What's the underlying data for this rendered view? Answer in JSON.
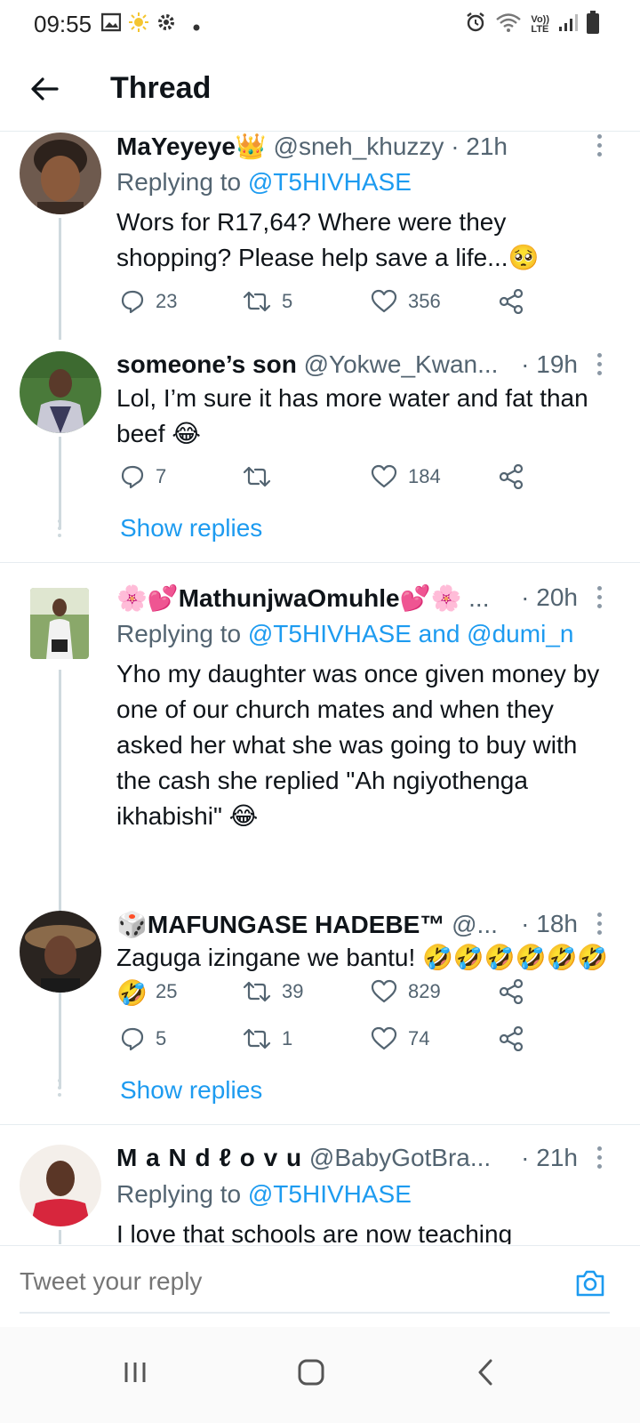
{
  "status_bar": {
    "time": "09:55",
    "left_icons": [
      "gallery-icon",
      "sun-icon",
      "gear-icon",
      "dot-icon"
    ],
    "right_icons": [
      "alarm-icon",
      "wifi-icon",
      "volte-icon",
      "signal-icon",
      "battery-icon"
    ],
    "volte_label_top": "Vo))",
    "volte_label_bottom": "LTE"
  },
  "header": {
    "title": "Thread",
    "back_icon": "back-arrow-icon"
  },
  "tweets": [
    {
      "name": "MaYeyeye👑",
      "handle": "@sneh_khuzzy",
      "time": "· 21h",
      "replying_prefix": "Replying to ",
      "replying_to": "@T5HIVHASE",
      "text": "Wors for R17,64? Where were they shopping? Please help save a life...🥺",
      "replies": "23",
      "retweets": "5",
      "likes": "356"
    },
    {
      "name": "someone’s son",
      "handle": "@Yokwe_Kwan...",
      "time": "· 19h",
      "text": "Lol, I’m sure it has more water and fat than beef 😂",
      "replies": "7",
      "retweets": "",
      "likes": "184",
      "show_replies": "Show replies"
    },
    {
      "name": "🌸💕MathunjwaOmuhle💕🌸",
      "handle": "...",
      "time": "· 20h",
      "replying_prefix": "Replying to ",
      "replying_to": "@T5HIVHASE and @dumi_n",
      "text": "Yho my daughter was once given money by one of our church mates and when they asked her what she was going to buy with the cash she replied \"Ah ngiyothenga ikhabishi\" 😂",
      "replies": "25",
      "retweets": "39",
      "likes": "829"
    },
    {
      "name": "🎲MAFUNGASE HADEBE™",
      "handle": "@...",
      "time": "· 18h",
      "text": "Zaguga izingane we bantu! 🤣🤣🤣🤣🤣🤣🤣",
      "replies": "5",
      "retweets": "1",
      "likes": "74",
      "show_replies": "Show replies"
    },
    {
      "name": "M a N d ℓ o v u",
      "handle": "@BabyGotBra...",
      "time": "· 21h",
      "replying_prefix": "Replying to ",
      "replying_to": "@T5HIVHASE",
      "text": "I love that schools are now teaching"
    }
  ],
  "reply_box": {
    "placeholder": "Tweet your reply",
    "camera_icon": "camera-icon"
  },
  "nav_bar": {
    "icons": [
      "recents-icon",
      "home-icon",
      "back-icon"
    ]
  },
  "colors": {
    "link": "#1d9bf0",
    "text": "#0f1419",
    "secondary": "#536471",
    "divider": "#e6ecf0"
  }
}
